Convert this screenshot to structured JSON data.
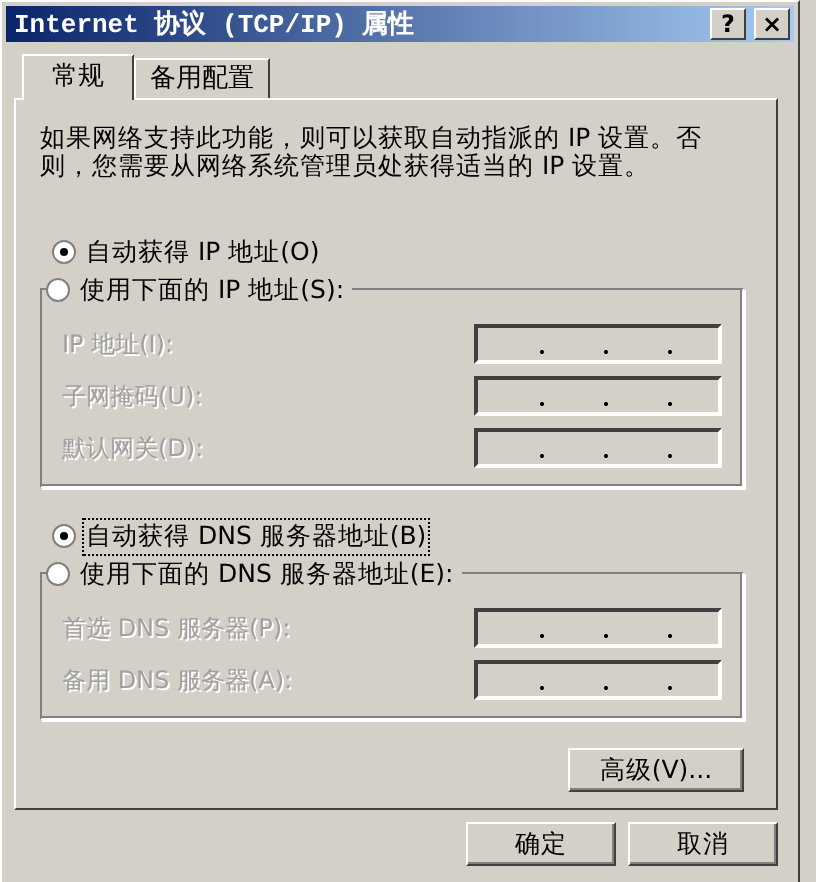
{
  "window": {
    "title": "Internet 协议 (TCP/IP) 属性",
    "buttons": [
      {
        "kind": "help",
        "label": "?"
      },
      {
        "kind": "close",
        "label": "×"
      }
    ]
  },
  "tabs": [
    {
      "label": "常规",
      "selected": true
    },
    {
      "label": "备用配置",
      "selected": false
    }
  ],
  "description": "如果网络支持此功能，则可以获取自动指派的 IP 设置。否则，您需要从网络系统管理员处获得适当的 IP 设置。",
  "sections": [
    {
      "auto_option": {
        "label": "自动获得 IP 地址(O)",
        "selected": true,
        "focused": false
      },
      "manual_option": {
        "label": "使用下面的 IP 地址(S):",
        "selected": false
      },
      "fields": [
        {
          "label": "IP 地址(I):",
          "disabled": true
        },
        {
          "label": "子网掩码(U):",
          "disabled": true
        },
        {
          "label": "默认网关(D):",
          "disabled": true
        }
      ]
    },
    {
      "auto_option": {
        "label": "自动获得 DNS 服务器地址(B)",
        "selected": true,
        "focused": true
      },
      "manual_option": {
        "label": "使用下面的 DNS 服务器地址(E):",
        "selected": false
      },
      "fields": [
        {
          "label": "首选 DNS 服务器(P):",
          "disabled": true
        },
        {
          "label": "备用 DNS 服务器(A):",
          "disabled": true
        }
      ]
    }
  ],
  "advanced_button": "高级(V)...",
  "footer_buttons": [
    "确定",
    "取消"
  ]
}
